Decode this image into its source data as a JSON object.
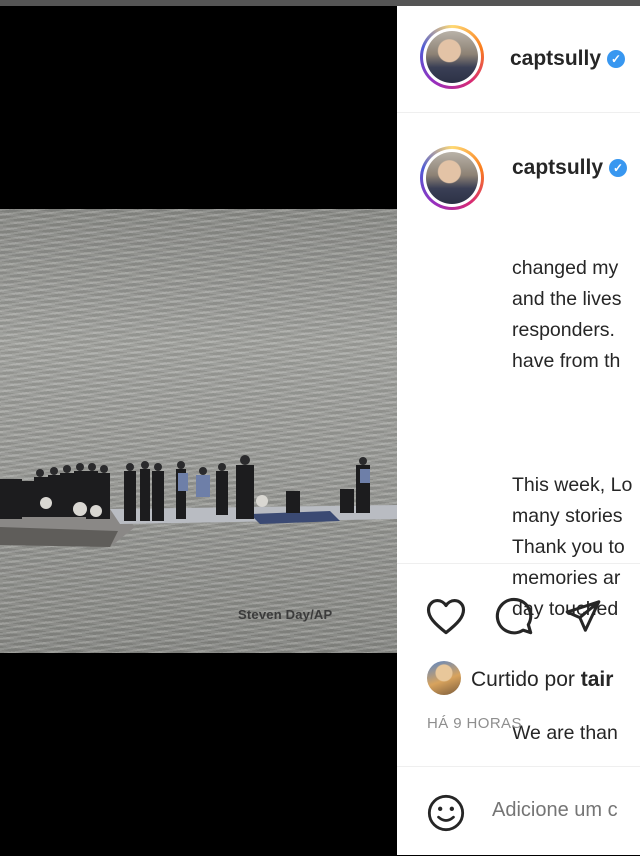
{
  "header": {
    "username": "captsully",
    "verified_icon": "verified-badge-icon"
  },
  "photo": {
    "credit": "Steven Day/AP"
  },
  "caption": {
    "username": "captsully",
    "lines": [
      "changed my",
      "and the lives",
      "responders.",
      "have from th"
    ],
    "para2": [
      "This week, Lo",
      "many stories",
      "Thank you to",
      "memories ar",
      "day touched"
    ],
    "para3": [
      "We are than"
    ]
  },
  "actions": {
    "like_icon": "heart-icon",
    "comment_icon": "comment-icon",
    "share_icon": "share-icon"
  },
  "likes": {
    "prefix": "Curtido por",
    "name": "tair"
  },
  "timestamp": "HÁ 9 HORAS",
  "comment": {
    "emoji_icon": "smiley-icon",
    "placeholder": "Adicione um c"
  }
}
